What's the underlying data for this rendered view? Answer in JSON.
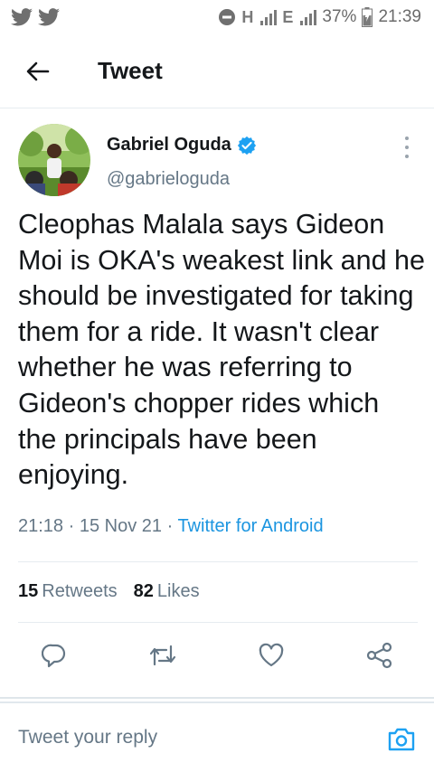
{
  "status_bar": {
    "notification_icons": [
      "twitter-icon",
      "twitter-icon"
    ],
    "network_1": "H",
    "network_2": "E",
    "battery_percent": "37%",
    "time": "21:39"
  },
  "header": {
    "title": "Tweet"
  },
  "tweet": {
    "author_name": "Gabriel Oguda",
    "author_handle": "@gabrieloguda",
    "text": "Cleophas Malala says Gideon Moi is OKA's weakest link and he should be investigated for taking them for a ride. It wasn't clear whether he was referring to Gideon's chopper rides which the principals have been enjoying.",
    "time": "21:18",
    "date": "15 Nov 21",
    "source": "Twitter for Android",
    "separator": " · ",
    "retweets_count": "15",
    "retweets_label": "Retweets",
    "likes_count": "82",
    "likes_label": "Likes"
  },
  "reply": {
    "placeholder": "Tweet your reply"
  },
  "colors": {
    "accent": "#1DA1F2",
    "link": "#1b95e0",
    "secondary_text": "#657786",
    "icon_gray": "#657786"
  }
}
